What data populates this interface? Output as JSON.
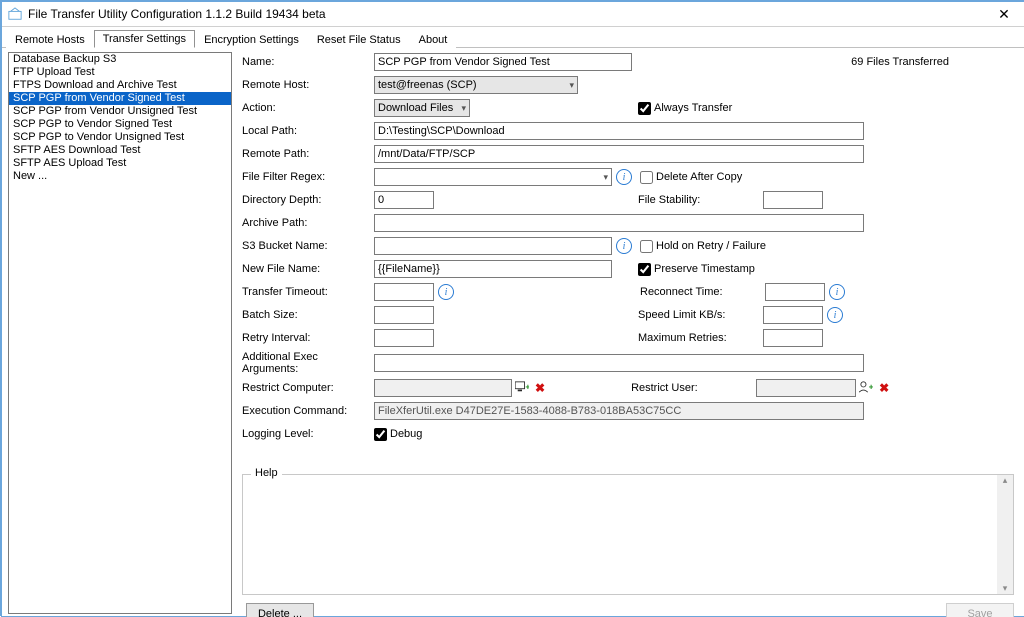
{
  "window": {
    "title": "File Transfer Utility Configuration 1.1.2 Build 19434 beta"
  },
  "tabs": [
    "Remote Hosts",
    "Transfer Settings",
    "Encryption Settings",
    "Reset File Status",
    "About"
  ],
  "active_tab_index": 1,
  "sidebar": {
    "items": [
      "Database Backup S3",
      "FTP Upload Test",
      "FTPS Download and Archive Test",
      "SCP PGP from Vendor Signed Test",
      "SCP PGP from Vendor Unsigned Test",
      "SCP PGP to Vendor Signed Test",
      "SCP PGP to Vendor Unsigned Test",
      "SFTP AES Download Test",
      "SFTP AES Upload Test",
      "New ..."
    ],
    "selected_index": 3
  },
  "header": {
    "files_transferred": "69 Files Transferred"
  },
  "labels": {
    "name": "Name:",
    "remote_host": "Remote Host:",
    "action": "Action:",
    "always_transfer": "Always Transfer",
    "local_path": "Local Path:",
    "remote_path": "Remote Path:",
    "file_filter_regex": "File Filter Regex:",
    "delete_after_copy": "Delete After Copy",
    "directory_depth": "Directory Depth:",
    "file_stability": "File Stability:",
    "archive_path": "Archive Path:",
    "s3_bucket_name": "S3 Bucket Name:",
    "hold_on_retry": "Hold on Retry / Failure",
    "new_file_name": "New File Name:",
    "preserve_timestamp": "Preserve Timestamp",
    "transfer_timeout": "Transfer Timeout:",
    "reconnect_time": "Reconnect Time:",
    "batch_size": "Batch Size:",
    "speed_limit": "Speed Limit KB/s:",
    "retry_interval": "Retry Interval:",
    "maximum_retries": "Maximum Retries:",
    "additional_exec": "Additional Exec Arguments:",
    "restrict_computer": "Restrict Computer:",
    "restrict_user": "Restrict User:",
    "execution_command": "Execution Command:",
    "logging_level": "Logging Level:",
    "debug": "Debug",
    "help": "Help",
    "delete": "Delete ...",
    "save": "Save"
  },
  "values": {
    "name": "SCP PGP from Vendor Signed Test",
    "remote_host": "test@freenas (SCP)",
    "action": "Download Files",
    "always_transfer_checked": true,
    "local_path": "D:\\Testing\\SCP\\Download",
    "remote_path": "/mnt/Data/FTP/SCP",
    "file_filter_regex": "",
    "delete_after_copy_checked": false,
    "directory_depth": "0",
    "file_stability": "",
    "archive_path": "",
    "s3_bucket_name": "",
    "hold_on_retry_checked": false,
    "new_file_name": "{{FileName}}",
    "preserve_timestamp_checked": true,
    "transfer_timeout": "",
    "reconnect_time": "",
    "batch_size": "",
    "speed_limit": "",
    "retry_interval": "",
    "maximum_retries": "",
    "additional_exec": "",
    "restrict_computer": "",
    "restrict_user": "",
    "execution_command": "FileXferUtil.exe D47DE27E-1583-4088-B783-018BA53C75CC",
    "debug_checked": true
  }
}
